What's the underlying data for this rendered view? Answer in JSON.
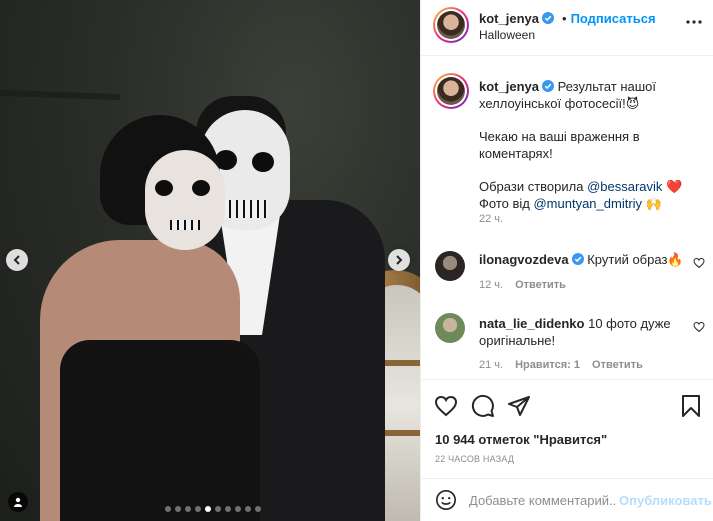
{
  "header": {
    "username": "kot_jenya",
    "follow_label": "Подписаться",
    "separator": "•",
    "location": "Halloween"
  },
  "caption": {
    "username": "kot_jenya",
    "line1": "Результат нашої хеллоуінської фотосесії!",
    "line1_emoji": "😈",
    "line2": "Чекаю на ваші враження в коментарях!",
    "line3_prefix": "Образи створила ",
    "line3_mention": "@bessaravik",
    "line3_emoji": "❤️",
    "line4_prefix": "Фото від ",
    "line4_mention": "@muntyan_dmitriy",
    "line4_emoji": "🙌",
    "time": "22 ч."
  },
  "comments": [
    {
      "username": "ilonagvozdeva",
      "verified": true,
      "text": "Крутий образ",
      "emoji": "🔥",
      "time": "12 ч.",
      "reply": "Ответить"
    },
    {
      "username": "nata_lie_didenko",
      "verified": false,
      "text": "10 фото дуже оригінальне!",
      "time": "21 ч.",
      "likes": "Нравится: 1",
      "reply": "Ответить"
    }
  ],
  "actions": {
    "likes_count": "10 944 отметок \"Нравится\"",
    "post_time": "22 ЧАСОВ НАЗАД"
  },
  "add_comment": {
    "placeholder": "Добавьте комментарий...",
    "publish_label": "Опубликовать"
  },
  "carousel": {
    "total_slides": 10,
    "active_slide": 5
  },
  "icons": {
    "verified": "verified-badge-icon",
    "more": "more-options-icon",
    "heart": "heart-icon",
    "comment": "comment-icon",
    "share": "share-icon",
    "save": "bookmark-icon",
    "emoji": "emoji-icon",
    "prev": "chevron-left-icon",
    "next": "chevron-right-icon",
    "tag": "user-tag-icon"
  },
  "colors": {
    "accent": "#0095f6",
    "verified": "#3897f0",
    "publish_disabled": "#b2dffc",
    "muted": "#8e8e8e",
    "text": "#262626"
  }
}
